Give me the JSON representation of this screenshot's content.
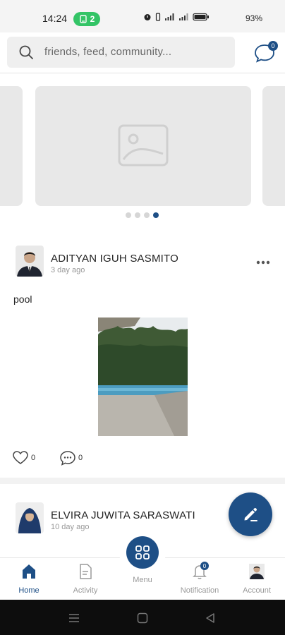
{
  "status_bar": {
    "time": "14:24",
    "notification_count": "2",
    "battery_percent": "93%"
  },
  "header": {
    "search_placeholder": "friends, feed, community...",
    "chat_badge": "0"
  },
  "carousel": {
    "slide_count": 4,
    "active_index": 3
  },
  "posts": [
    {
      "author": "ADITYAN IGUH SASMITO",
      "time_ago": "3 day ago",
      "text": "pool",
      "likes": "0",
      "comments": "0"
    },
    {
      "author": "ELVIRA JUWITA SARASWATI",
      "time_ago": "10 day ago"
    }
  ],
  "bottom_nav": {
    "home": "Home",
    "activity": "Activity",
    "menu": "Menu",
    "notification": "Notification",
    "notification_badge": "0",
    "account": "Account"
  },
  "colors": {
    "primary": "#1e4f86",
    "pill_green": "#33c466",
    "placeholder_gray": "#e8e8e8"
  }
}
